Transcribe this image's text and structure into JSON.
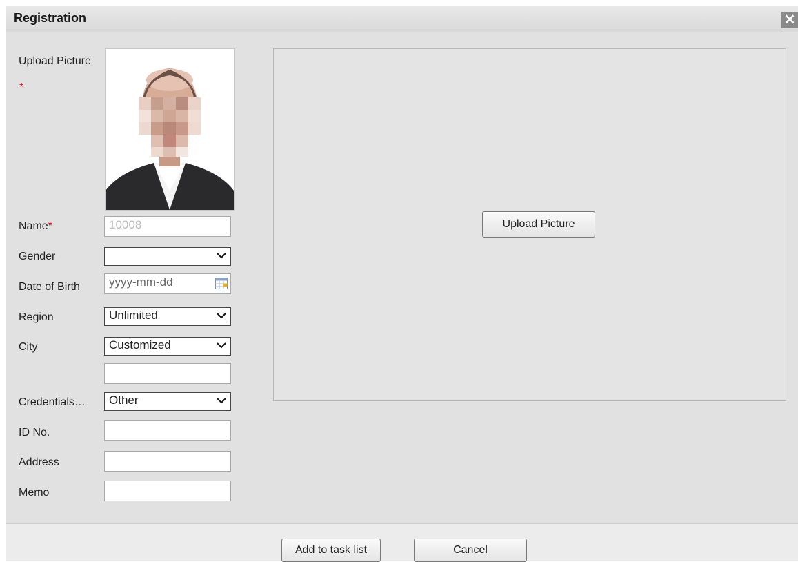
{
  "dialog": {
    "title": "Registration",
    "close_glyph": "✕"
  },
  "form": {
    "upload_picture_label": "Upload Picture",
    "upload_required_mark": "*",
    "name_label": "Name",
    "name_required_mark": "*",
    "name_value": "10008",
    "gender_label": "Gender",
    "gender_value": "",
    "dob_label": "Date of Birth",
    "dob_placeholder": "yyyy-mm-dd",
    "region_label": "Region",
    "region_value": "Unlimited",
    "city_label": "City",
    "city_value": "Customized",
    "city_custom_value": "",
    "credentials_label": "Credentials…",
    "credentials_value": "Other",
    "id_label": "ID No.",
    "id_value": "",
    "address_label": "Address",
    "address_value": "",
    "memo_label": "Memo",
    "memo_value": ""
  },
  "preview": {
    "upload_button": "Upload Picture"
  },
  "footer": {
    "add_button": "Add to task list",
    "cancel_button": "Cancel"
  },
  "icons": {
    "close": "close-icon",
    "dropdown": "chevron-down-icon",
    "calendar": "calendar-icon"
  },
  "colors": {
    "required": "#e0101a",
    "dialog_bg": "#e1e1e1",
    "close_bg": "#8a8a8a"
  }
}
